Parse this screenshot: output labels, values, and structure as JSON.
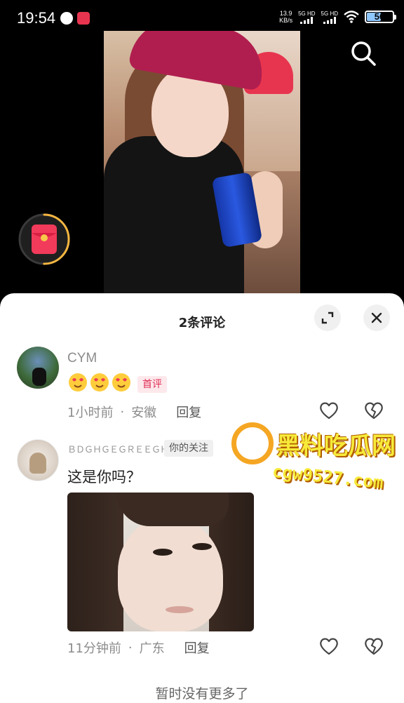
{
  "status_bar": {
    "time": "19:54",
    "net_speed_value": "13.9",
    "net_speed_unit": "KB/s",
    "sim1_label": "5G HD",
    "sim2_label": "5G HD",
    "battery_level": "56",
    "battery_fraction": 0.56
  },
  "video": {
    "search_icon": "search-icon",
    "redpacket_icon": "red-packet-icon",
    "redpacket_progress": 0.5
  },
  "comments_sheet": {
    "title": "2条评论",
    "expand_icon": "expand-icon",
    "close_icon": "close-icon",
    "comments": [
      {
        "username": "CYM",
        "emojis": [
          "😍",
          "😍",
          "😍"
        ],
        "tag": "首评",
        "time": "1小时前",
        "location": "安徽",
        "separator": "·",
        "reply_label": "回复"
      },
      {
        "username": "ＢＤＧＨＧＥＧＲＥＥＧＨ",
        "tag": "你的关注",
        "text": "这是你吗？",
        "time": "11分钟前",
        "location": "广东",
        "separator": "·",
        "reply_label": "回复"
      }
    ],
    "footer": "暂时没有更多了"
  },
  "watermark": {
    "text": "黑料吃瓜网",
    "url": "cgw9527.com"
  },
  "colors": {
    "accent_red": "#e02e55",
    "watermark_yellow": "#f7ea3a",
    "watermark_orange": "#f5a623"
  }
}
